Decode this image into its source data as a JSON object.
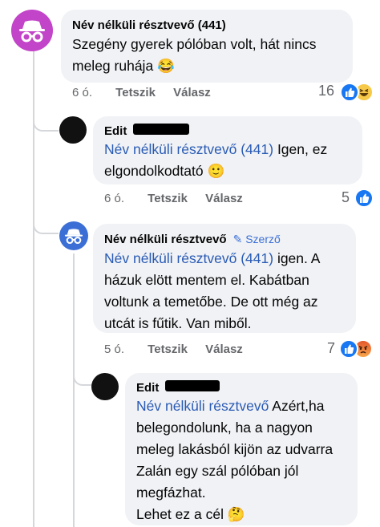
{
  "comments": [
    {
      "author": "Név nélküli résztvevő (441)",
      "lines": [
        "Szegény gyerek pólóban volt, hát nincs",
        "meleg ruhája"
      ],
      "emoji": "😂",
      "time": "6 ó.",
      "like_label": "Tetszik",
      "reply_label": "Válasz",
      "reaction_count": "16",
      "reaction_icons": [
        "like-icon",
        "haha-icon"
      ]
    },
    {
      "author": "Edit",
      "mention": "Név nélküli résztvevő (441)",
      "lines": [
        "Igen, ez",
        "elgondolkodtató"
      ],
      "emoji": "🙂",
      "time": "6 ó.",
      "like_label": "Tetszik",
      "reply_label": "Válasz",
      "reaction_count": "5",
      "reaction_icons": [
        "like-icon"
      ]
    },
    {
      "author": "Név nélküli résztvevő",
      "author_badge": "Szerző",
      "mention": "Név nélküli résztvevő (441)",
      "lines": [
        "igen. A",
        "házuk elött mentem el. Kabátban",
        "voltunk a temetőbe. De ott még az",
        "utcát is fűtik. Van miből."
      ],
      "time": "5 ó.",
      "like_label": "Tetszik",
      "reply_label": "Válasz",
      "reaction_count": "7",
      "reaction_icons": [
        "like-icon",
        "angry-icon"
      ]
    },
    {
      "author": "Edit",
      "mention": "Név nélküli résztvevő",
      "lines": [
        "Azért,ha",
        "belegondolunk, ha a nagyon",
        "meleg lakásból kijön az udvarra",
        "Zalán egy szál pólóban jól",
        "megfázhat.",
        "Lehet ez a cél"
      ],
      "emoji": "🤔"
    }
  ],
  "colors": {
    "bubble": "#f0f2f5",
    "mention": "#2a5bb5",
    "like_blue": "#1877f2",
    "anon_avatar": "#c244c8",
    "anon_avatar_reply": "#3b6fd6",
    "meta_text": "#65676b"
  }
}
